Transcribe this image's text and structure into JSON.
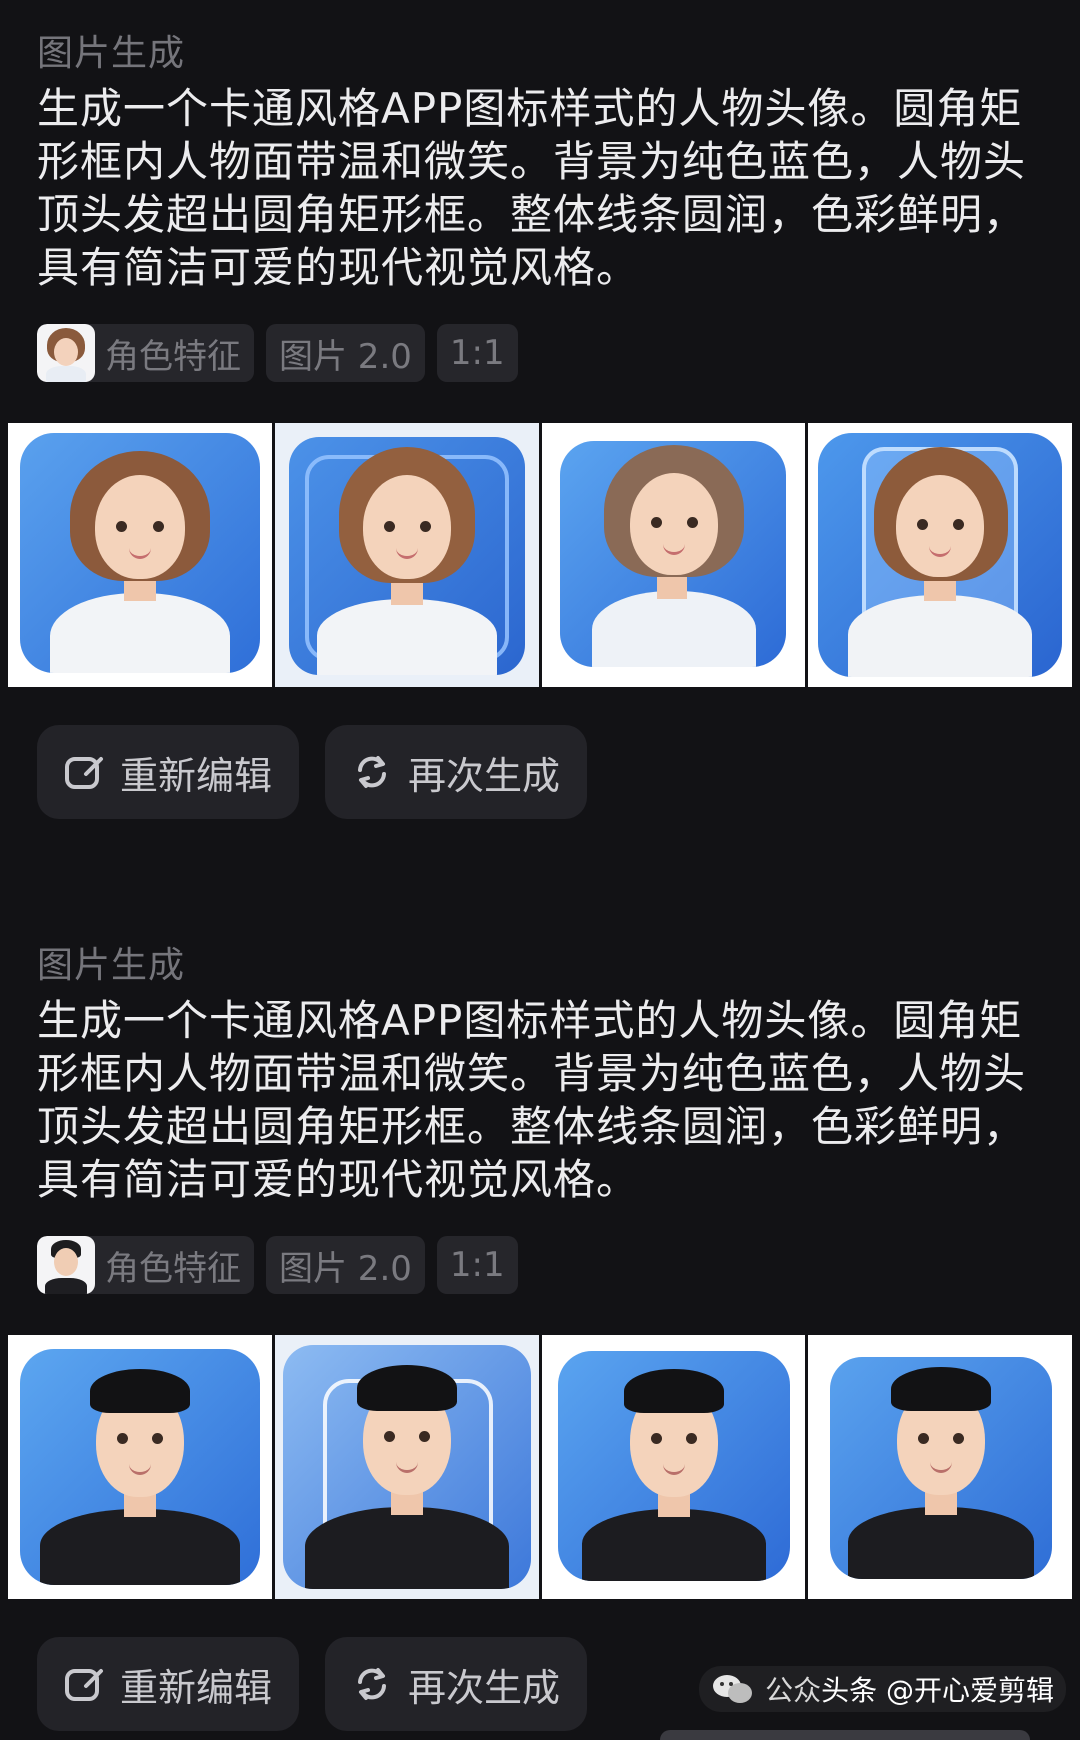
{
  "blocks": [
    {
      "section_label": "图片生成",
      "prompt": "生成一个卡通风格APP图标样式的人物头像。圆角矩形框内人物面带温和微笑。背景为纯色蓝色，人物头顶头发超出圆角矩形框。整体线条圆润，色彩鲜明，具有简洁可爱的现代视觉风格。",
      "tags": {
        "role": "角色特征",
        "model": "图片 2.0",
        "ratio": "1:1"
      },
      "character": "girl",
      "actions": {
        "edit": "重新编辑",
        "regenerate": "再次生成"
      }
    },
    {
      "section_label": "图片生成",
      "prompt": "生成一个卡通风格APP图标样式的人物头像。圆角矩形框内人物面带温和微笑。背景为纯色蓝色，人物头顶头发超出圆角矩形框。整体线条圆润，色彩鲜明，具有简洁可爱的现代视觉风格。",
      "tags": {
        "role": "角色特征",
        "model": "图片 2.0",
        "ratio": "1:1"
      },
      "character": "boy",
      "actions": {
        "edit": "重新编辑",
        "regenerate": "再次生成"
      }
    }
  ],
  "watermark": {
    "prefix": "公众",
    "text": "头条 @开心爱剪辑"
  },
  "colors": {
    "accent_blue": "#3f86e6",
    "background": "#121215",
    "chip": "#26262b"
  },
  "icons": {
    "edit": "edit-icon",
    "regenerate": "refresh-icon",
    "wechat": "wechat-icon"
  }
}
